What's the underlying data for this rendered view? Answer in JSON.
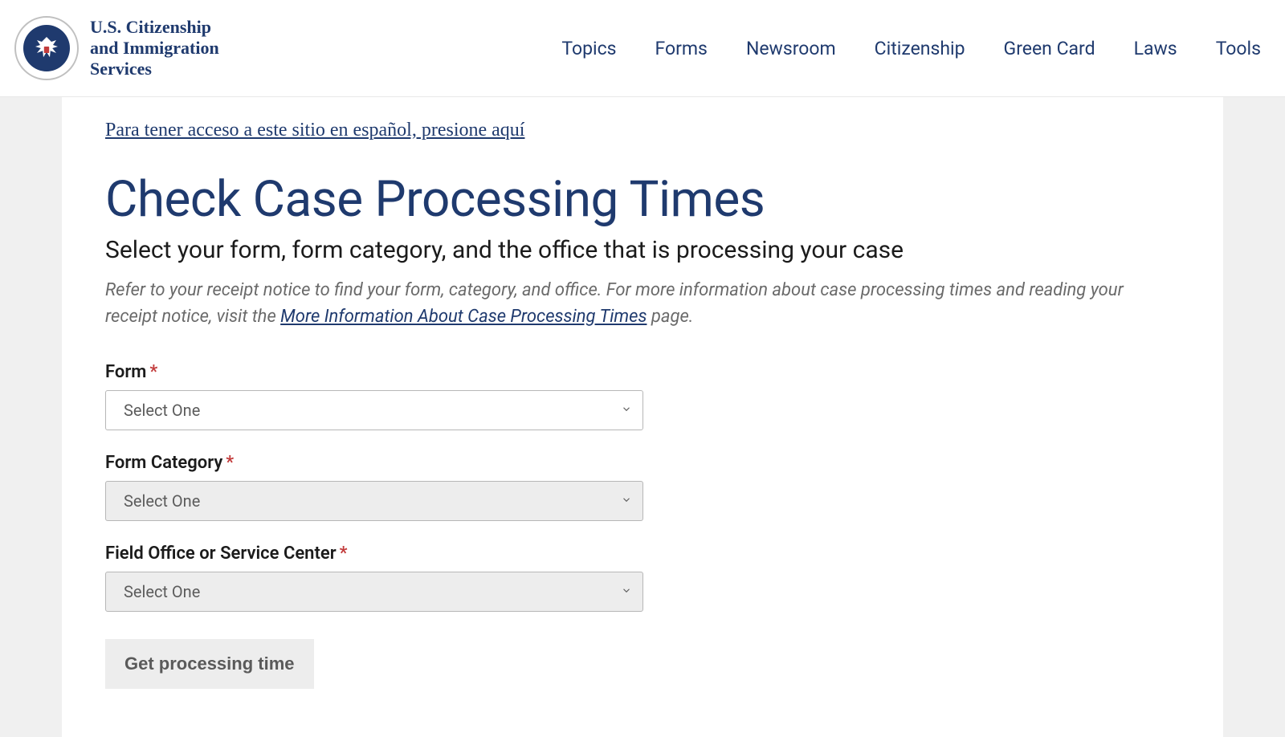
{
  "header": {
    "org_name": "U.S. Citizenship\nand Immigration\nServices",
    "nav": [
      "Topics",
      "Forms",
      "Newsroom",
      "Citizenship",
      "Green Card",
      "Laws",
      "Tools"
    ]
  },
  "content": {
    "spanish_link": "Para tener acceso a este sitio en español, presione aquí",
    "title": "Check Case Processing Times",
    "subtitle": "Select your form, form category, and the office that is processing your case",
    "intro_pre": "Refer to your receipt notice to find your form, category, and office. For more information about case processing times and reading your receipt notice, visit the ",
    "intro_link": "More Information About Case Processing Times",
    "intro_post": " page.",
    "form": {
      "field1": {
        "label": "Form",
        "placeholder": "Select One",
        "disabled": false
      },
      "field2": {
        "label": "Form Category",
        "placeholder": "Select One",
        "disabled": true
      },
      "field3": {
        "label": "Field Office or Service Center",
        "placeholder": "Select One",
        "disabled": true
      },
      "submit": "Get processing time"
    }
  }
}
